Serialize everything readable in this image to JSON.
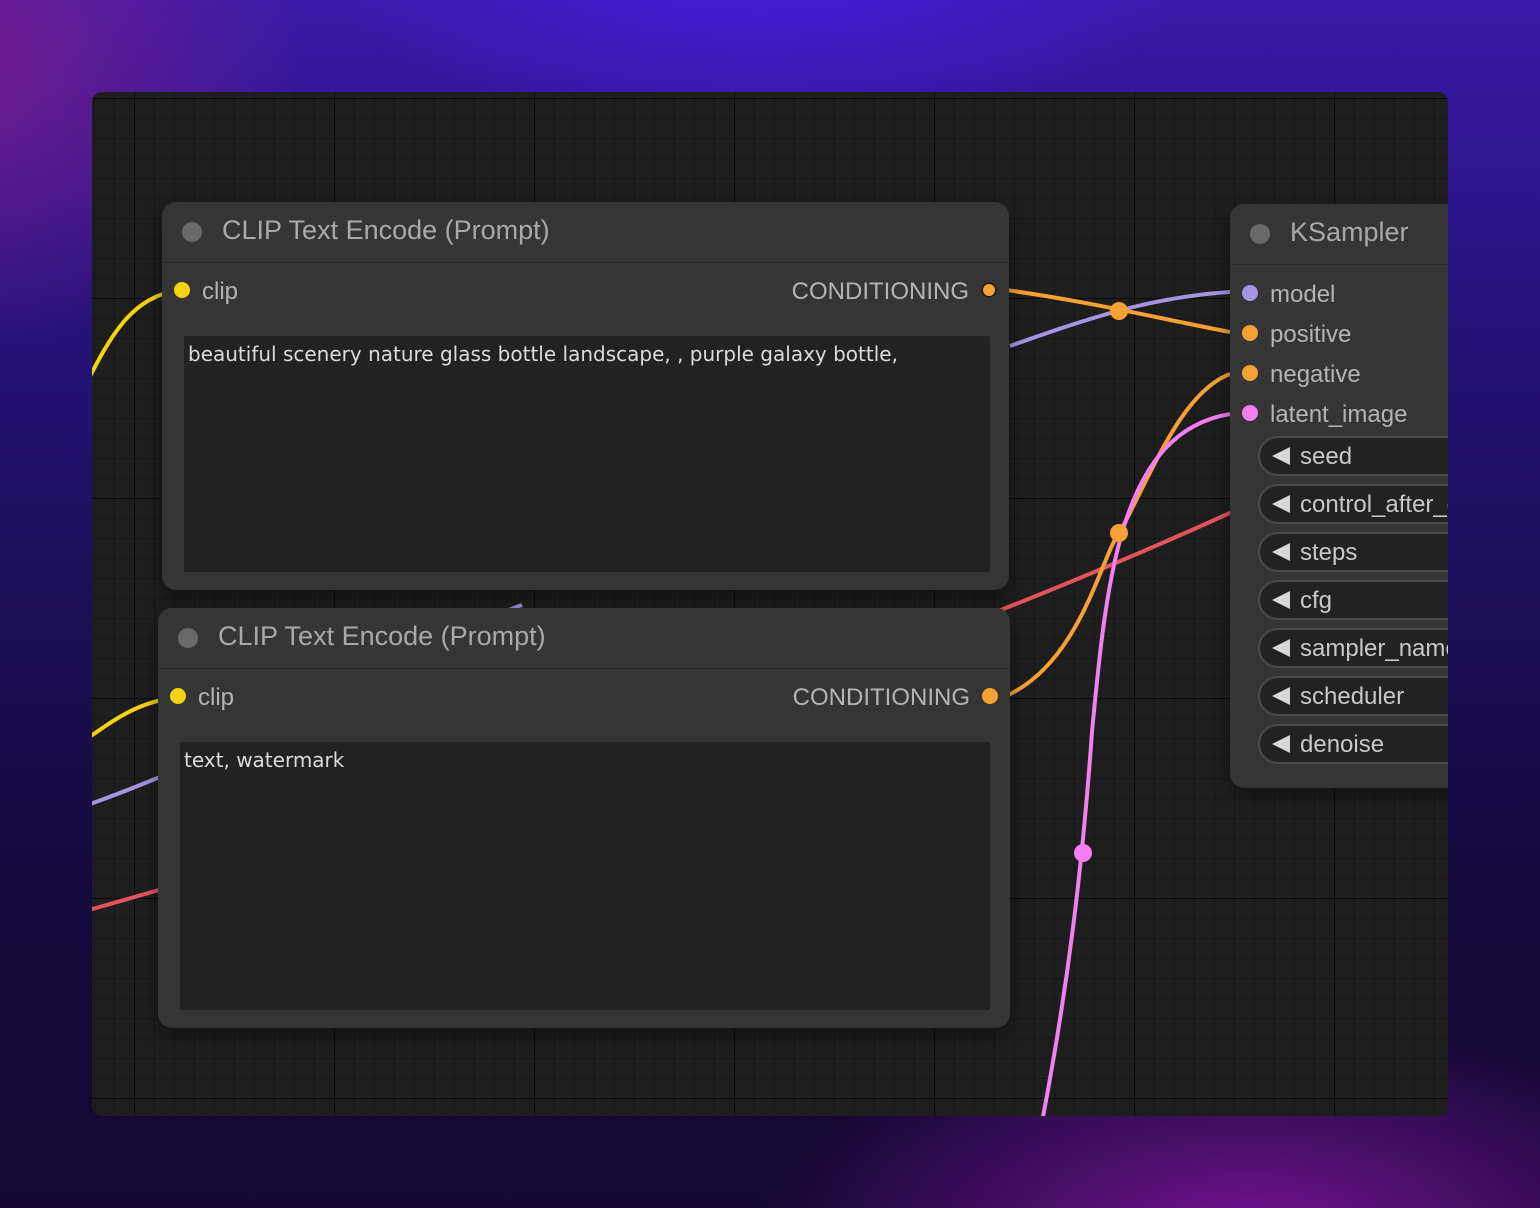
{
  "colors": {
    "clip": "#f5d30f",
    "conditioning": "#f7a034",
    "model": "#a594e0",
    "latent": "#f57ef0",
    "vae": "#e2535b",
    "node_bg": "#353535",
    "canvas_bg": "#1e1e1e"
  },
  "nodes": {
    "clip_positive": {
      "title": "CLIP Text Encode (Prompt)",
      "input_label": "clip",
      "output_label": "CONDITIONING",
      "text": "beautiful scenery nature glass bottle landscape, , purple galaxy bottle,"
    },
    "clip_negative": {
      "title": "CLIP Text Encode (Prompt)",
      "input_label": "clip",
      "output_label": "CONDITIONING",
      "text": "text, watermark"
    },
    "ksampler": {
      "title": "KSampler",
      "inputs": [
        "model",
        "positive",
        "negative",
        "latent_image"
      ],
      "widgets": [
        "seed",
        "control_after_generate",
        "steps",
        "cfg",
        "sampler_name",
        "scheduler",
        "denoise"
      ]
    }
  }
}
